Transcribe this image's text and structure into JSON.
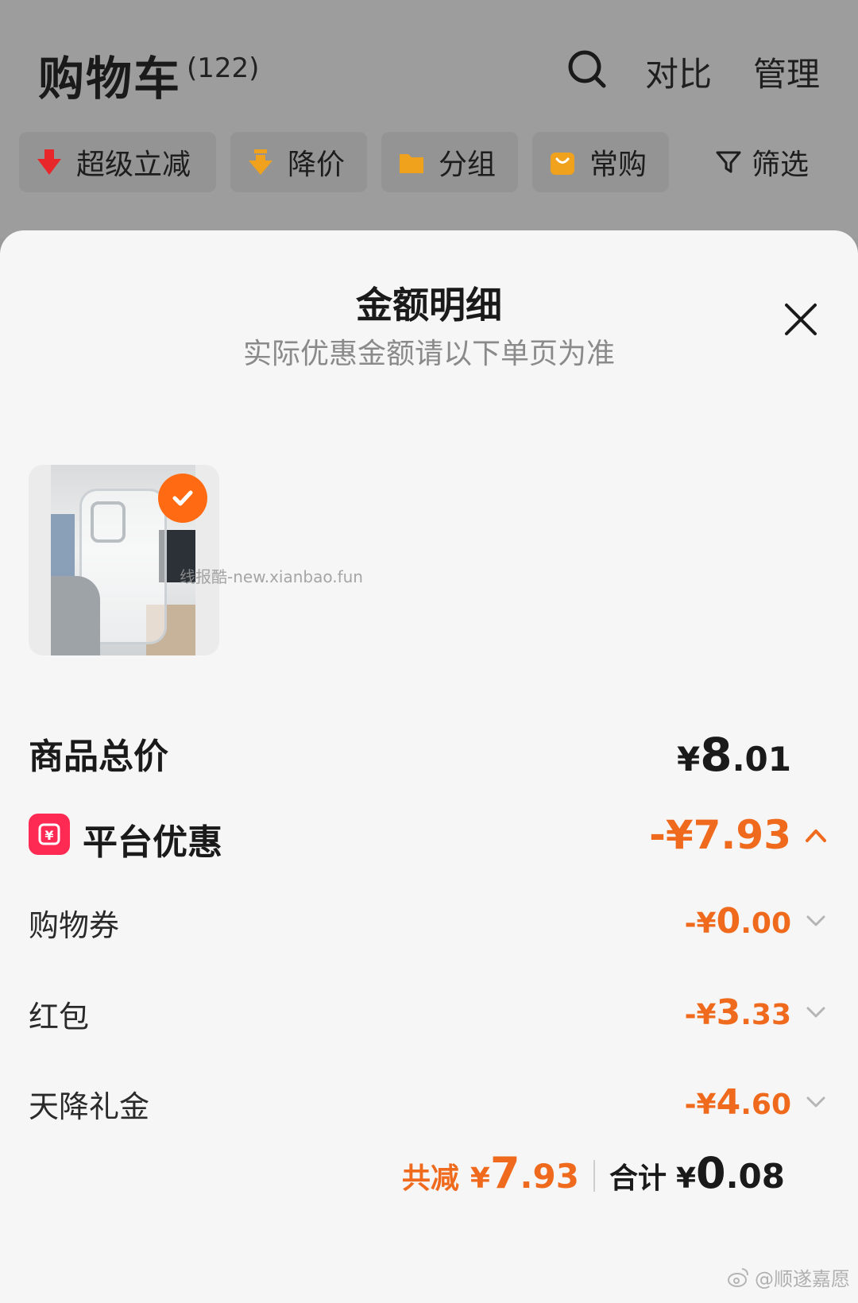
{
  "header": {
    "title": "购物车",
    "count": "(122)",
    "compare_label": "对比",
    "manage_label": "管理"
  },
  "filters": [
    {
      "label": "超级立减",
      "icon": "red-down-arrow-icon"
    },
    {
      "label": "降价",
      "icon": "orange-down-arrow-icon"
    },
    {
      "label": "分组",
      "icon": "folder-icon"
    },
    {
      "label": "常购",
      "icon": "bag-icon"
    },
    {
      "label": "筛选",
      "icon": "filter-icon"
    }
  ],
  "sheet": {
    "title": "金额明细",
    "subtitle": "实际优惠金额请以下单页为准",
    "watermark": "线报酷-new.xianbao.fun",
    "total": {
      "label": "商品总价",
      "currency": "¥",
      "int": "8",
      "dec": ".01"
    },
    "platform": {
      "label": "平台优惠",
      "badge": "¥",
      "prefix": "-¥",
      "int": "7",
      "dec": ".93"
    },
    "items": [
      {
        "label": "购物券",
        "prefix": "-¥",
        "int": "0",
        "dec": ".00"
      },
      {
        "label": "红包",
        "prefix": "-¥",
        "int": "3",
        "dec": ".33"
      },
      {
        "label": "天降礼金",
        "prefix": "-¥",
        "int": "4",
        "dec": ".60"
      }
    ],
    "summary": {
      "reduce_label": "共减",
      "reduce_prefix": "¥",
      "reduce_int": "7",
      "reduce_dec": ".93",
      "total_label": "合计",
      "total_prefix": "¥",
      "total_int": "0",
      "total_dec": ".08"
    }
  },
  "author_mark": "@顺遂嘉愿",
  "colors": {
    "accent": "#f06a1e",
    "check": "#ff6a12",
    "platform_badge": "#ff2a54"
  }
}
